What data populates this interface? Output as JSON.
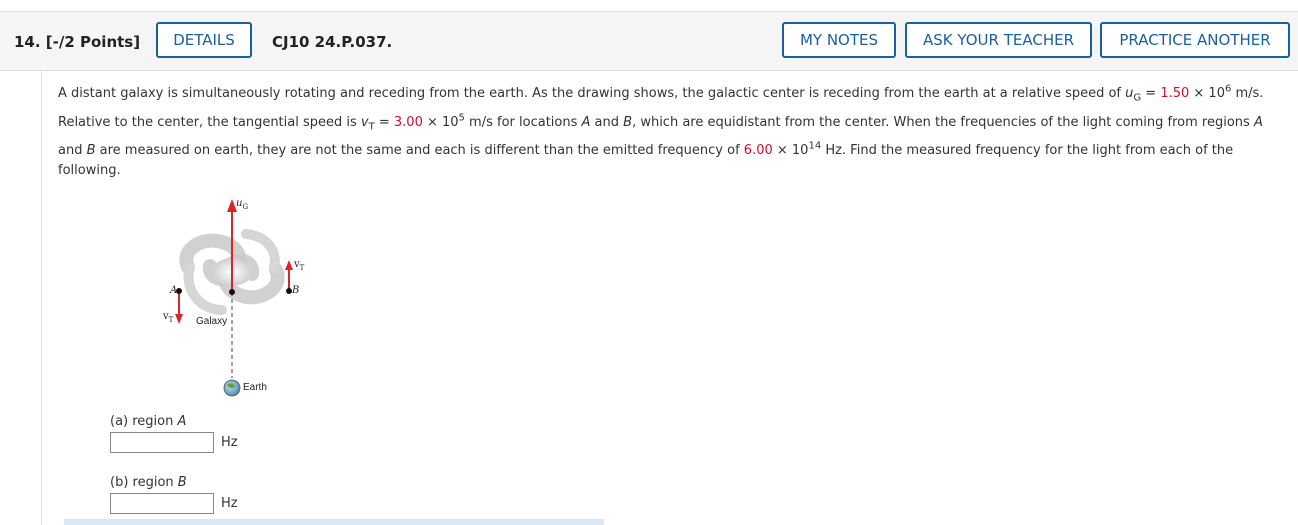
{
  "header": {
    "question_number": "14.  [-/2 Points]",
    "details_label": "DETAILS",
    "question_code": "CJ10 24.P.037.",
    "my_notes_label": "MY NOTES",
    "ask_teacher_label": "ASK YOUR TEACHER",
    "practice_another_label": "PRACTICE ANOTHER"
  },
  "question": {
    "line1_text": "A distant galaxy is simultaneously rotating and receding from the earth. As the drawing shows, the galactic center is receding from the earth at a relative speed of ",
    "ug_symbol": "u",
    "ug_sub": "G",
    "ug_equals": " = ",
    "ug_mantissa": "1.50",
    "ug_times": " × 10",
    "ug_exp": "6",
    "ug_unit": " m/s.",
    "line2_text": "Relative to the center, the tangential speed is ",
    "vt_symbol": "v",
    "vt_sub": "T",
    "vt_equals": " = ",
    "vt_mantissa": "3.00",
    "vt_times": " × 10",
    "vt_exp": "5",
    "vt_after": " m/s for locations ",
    "loc_a": "A",
    "and_word": " and ",
    "loc_b": "B",
    "line2_end": ", which are equidistant from the center. When the frequencies of the light coming from regions ",
    "loc_a2": "A",
    "line3_and": "and ",
    "loc_b2": "B",
    "line3_text": " are measured on earth, they are not the same and each is different than the emitted frequency of ",
    "freq_mantissa": "6.00",
    "freq_times": " × 10",
    "freq_exp": "14",
    "freq_unit": " Hz. Find the measured frequency for the light from each of the following."
  },
  "figure": {
    "ug_label": "u",
    "ug_label_sub": "G",
    "vt_right_label": "v",
    "vt_right_sub": "T",
    "vt_left_label": "v",
    "vt_left_sub": "T",
    "a_label": "A",
    "b_label": "B",
    "galaxy_label": "Galaxy",
    "earth_label": "Earth",
    "arrow_color": "#d9252a"
  },
  "parts": [
    {
      "label_prefix": "(a) region ",
      "label_var": "A",
      "value": "",
      "unit": "Hz"
    },
    {
      "label_prefix": "(b) region ",
      "label_var": "B",
      "value": "",
      "unit": "Hz"
    }
  ]
}
